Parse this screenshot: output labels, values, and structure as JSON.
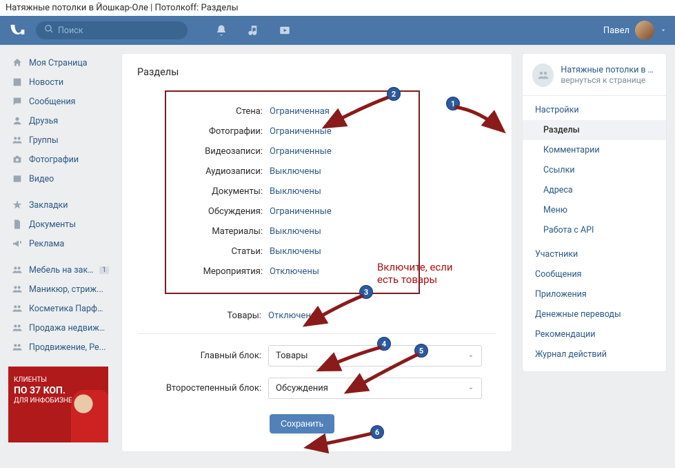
{
  "browser_title": "Натяжные потолки в Йошкар-Оле | Потолкоff: Разделы",
  "search_placeholder": "Поиск",
  "user_name": "Павел",
  "leftnav": {
    "my_page": "Моя Страница",
    "news": "Новости",
    "messages": "Сообщения",
    "friends": "Друзья",
    "groups": "Группы",
    "photos": "Фотографии",
    "videos": "Видео",
    "bookmarks": "Закладки",
    "documents": "Документы",
    "ads": "Реклама",
    "ext1": "Мебель на зака...",
    "ext1_badge": "1",
    "ext2": "Маникюр, стриж...",
    "ext3": "Косметика Парфю...",
    "ext4": "Продажа недвижи...",
    "ext5": "Продвижение, Ре..."
  },
  "ad": {
    "l1": "КЛИЕНТЫ",
    "l2": "ПО 37 КОП.",
    "l3": "ДЛЯ ИНФОБИЗНЕСА"
  },
  "page_title": "Разделы",
  "rows": {
    "wall_l": "Стена:",
    "wall_v": "Ограниченная",
    "photos_l": "Фотографии:",
    "photos_v": "Ограниченные",
    "videos_l": "Видеозаписи:",
    "videos_v": "Ограниченные",
    "audio_l": "Аудиозаписи:",
    "audio_v": "Выключены",
    "docs_l": "Документы:",
    "docs_v": "Выключены",
    "disc_l": "Обсуждения:",
    "disc_v": "Ограниченные",
    "mat_l": "Материалы:",
    "mat_v": "Выключены",
    "art_l": "Статьи:",
    "art_v": "Выключены",
    "events_l": "Мероприятия:",
    "events_v": "Отключены",
    "goods_l": "Товары:",
    "goods_v": "Отключены",
    "main_l": "Главный блок:",
    "main_v": "Товары",
    "sec_l": "Второстепенный блок:",
    "sec_v": "Обсуждения"
  },
  "save_label": "Сохранить",
  "right": {
    "group_name": "Натяжные потолки в Йо...",
    "back": "вернуться к странице",
    "settings": "Настройки",
    "sections": "Разделы",
    "comments": "Комментарии",
    "links": "Ссылки",
    "addresses": "Адреса",
    "menu": "Меню",
    "api": "Работа с API",
    "members": "Участники",
    "msgs": "Сообщения",
    "apps": "Приложения",
    "money": "Денежные переводы",
    "reco": "Рекомендации",
    "log": "Журнал действий"
  },
  "annotations": {
    "n1": "1",
    "n2": "2",
    "n3": "3",
    "n4": "4",
    "n5": "5",
    "n6": "6",
    "hint": "Включите, если есть товары"
  }
}
